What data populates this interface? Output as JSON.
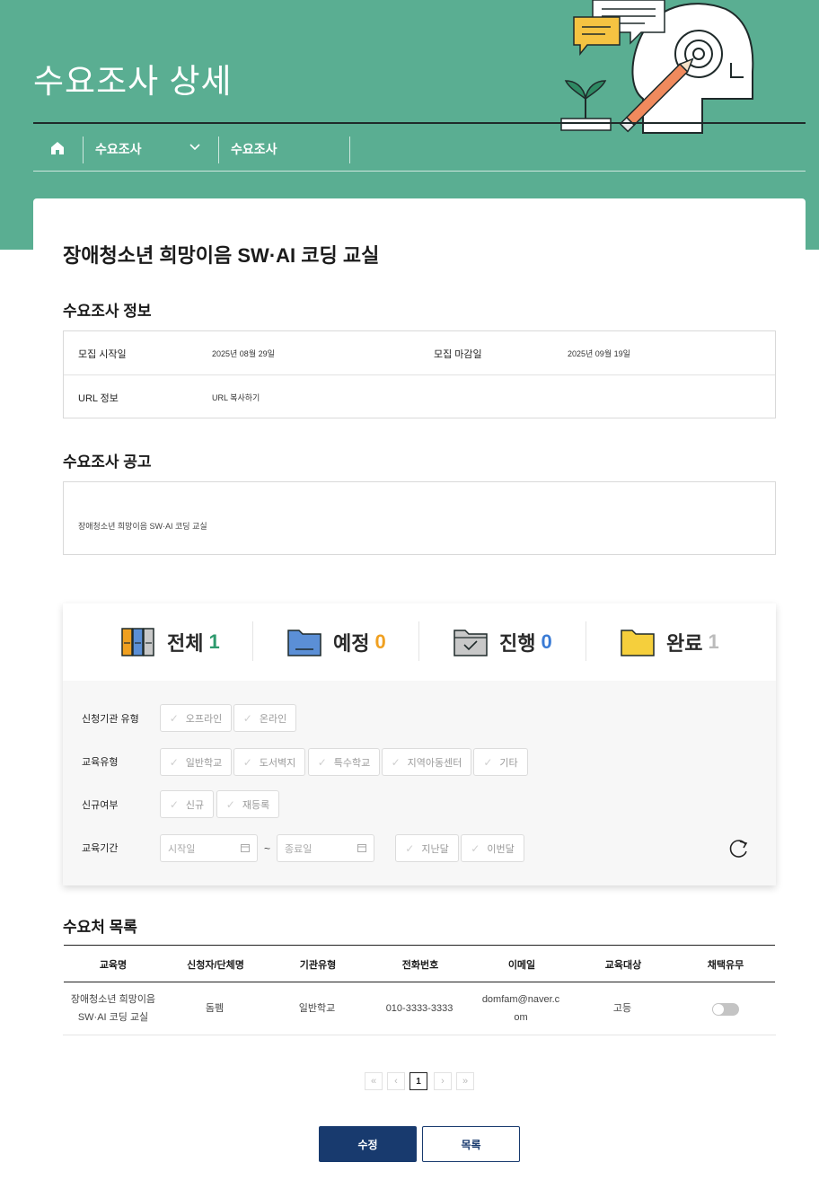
{
  "header": {
    "title": "수요조사 상세",
    "breadcrumb": {
      "home_icon": "home-icon",
      "level1": "수요조사",
      "level2": "수요조사"
    }
  },
  "detail": {
    "title": "장애청소년 희망이음 SW·AI 코딩 교실",
    "info_section_title": "수요조사 정보",
    "info": {
      "start_label": "모집 시작일",
      "start_value": "2025년 08월 29일",
      "end_label": "모집 마감일",
      "end_value": "2025년 09월 19일",
      "url_label": "URL 정보",
      "url_value": "URL 복사하기"
    },
    "notice_section_title": "수요조사 공고",
    "notice_text": "장애청소년 희망이음 SW·AI 코딩 교실"
  },
  "status": {
    "items": [
      {
        "label": "전체",
        "count": "1",
        "color": "#2e9a6e",
        "icon": "books-icon"
      },
      {
        "label": "예정",
        "count": "0",
        "color": "#f0a020",
        "icon": "folder-blue-icon"
      },
      {
        "label": "진행",
        "count": "0",
        "color": "#3a7bd5",
        "icon": "folder-check-icon"
      },
      {
        "label": "완료",
        "count": "1",
        "color": "#bbbbbb",
        "icon": "folder-yellow-icon"
      }
    ]
  },
  "filters": {
    "org_type_label": "신청기관 유형",
    "org_type_options": [
      "오프라인",
      "온라인"
    ],
    "edu_type_label": "교육유형",
    "edu_type_options": [
      "일반학교",
      "도서벽지",
      "특수학교",
      "지역아동센터",
      "기타"
    ],
    "new_label": "신규여부",
    "new_options": [
      "신규",
      "재등록"
    ],
    "period_label": "교육기간",
    "start_placeholder": "시작일",
    "end_placeholder": "종료일",
    "tilde": "~",
    "period_options": [
      "지난달",
      "이번달"
    ]
  },
  "list": {
    "title": "수요처 목록",
    "columns": [
      "교육명",
      "신청자/단체명",
      "기관유형",
      "전화번호",
      "이메일",
      "교육대상",
      "채택유무"
    ],
    "rows": [
      {
        "edu_name_l1": "장애청소년 희망이음",
        "edu_name_l2": "SW·AI 코딩 교실",
        "applicant": "돔펨",
        "org_type": "일반학교",
        "phone": "010-3333-3333",
        "email_l1": "domfam@naver.c",
        "email_l2": "om",
        "target": "고등",
        "adopted": false
      }
    ]
  },
  "pagination": {
    "first": "«",
    "prev": "‹",
    "current": "1",
    "next": "›",
    "last": "»"
  },
  "actions": {
    "edit_label": "수정",
    "list_label": "목록"
  }
}
